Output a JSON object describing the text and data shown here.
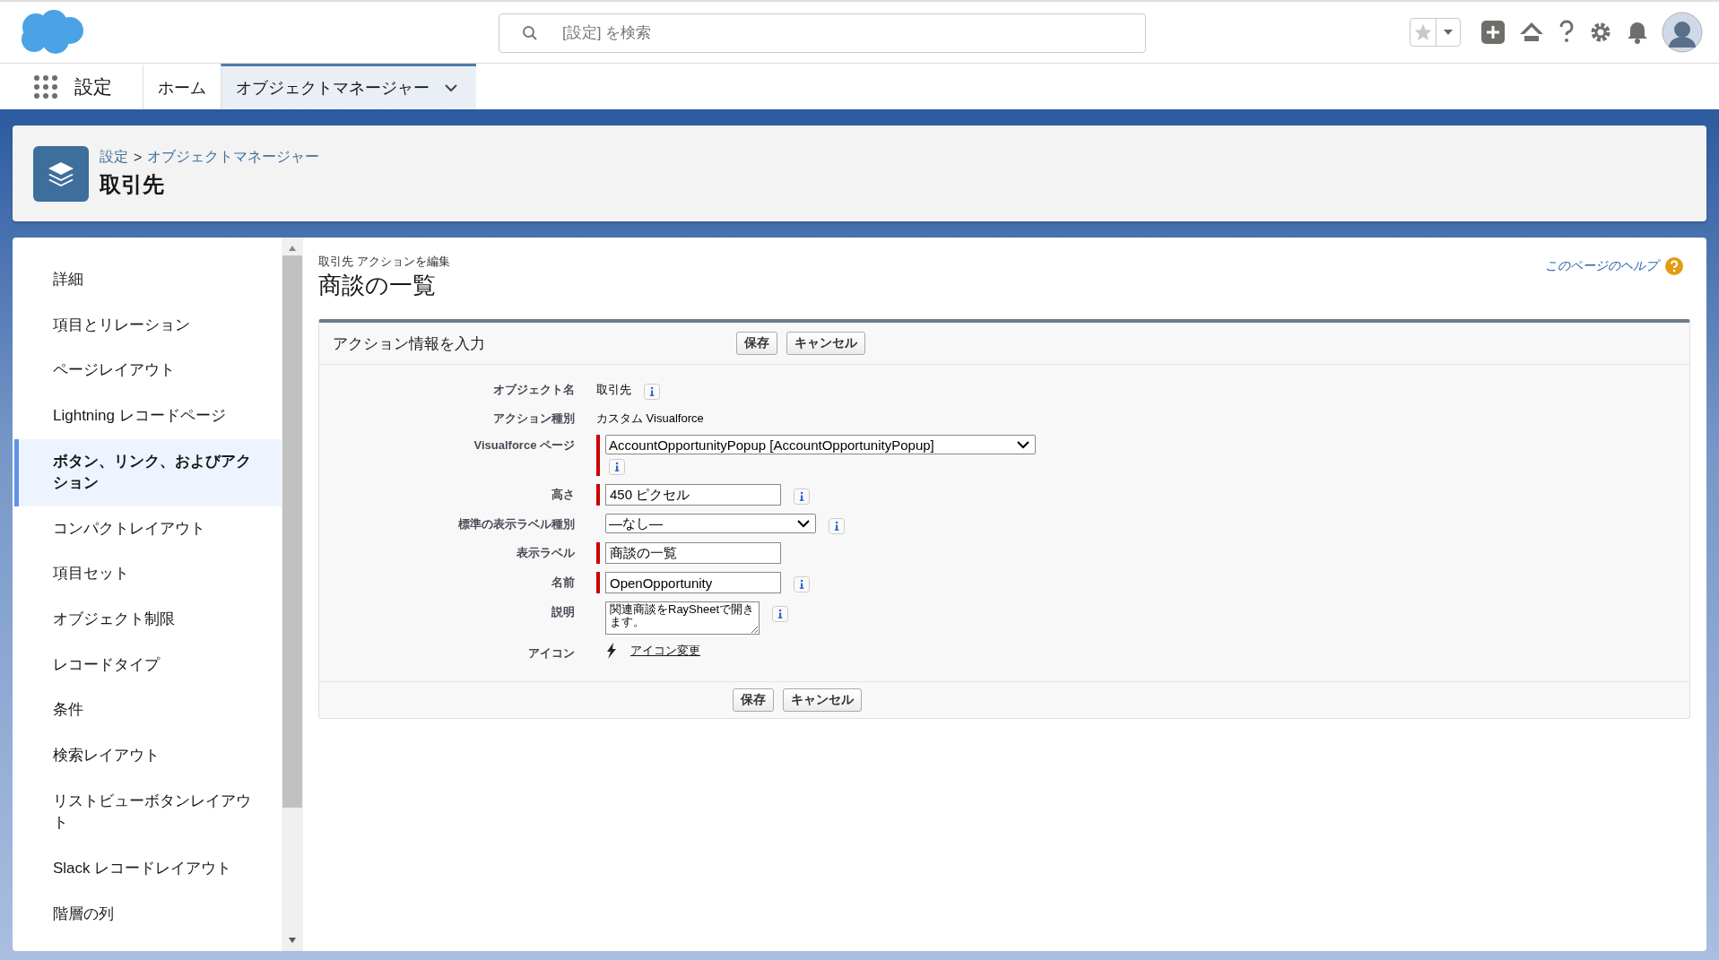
{
  "global_header": {
    "search": {
      "placeholder": "[設定] を検索"
    }
  },
  "nav": {
    "app_name": "設定",
    "tabs": [
      {
        "label": "ホーム",
        "selected": false,
        "dropdown": false
      },
      {
        "label": "オブジェクトマネージャー",
        "selected": true,
        "dropdown": true
      }
    ]
  },
  "page_header": {
    "breadcrumbs": [
      "設定",
      "オブジェクトマネージャー"
    ],
    "separator": ">",
    "title": "取引先"
  },
  "sidebar": {
    "items": [
      {
        "label": "詳細",
        "selected": false
      },
      {
        "label": "項目とリレーション",
        "selected": false
      },
      {
        "label": "ページレイアウト",
        "selected": false
      },
      {
        "label": "Lightning レコードページ",
        "selected": false
      },
      {
        "label": "ボタン、リンク、およびアクション",
        "selected": true
      },
      {
        "label": "コンパクトレイアウト",
        "selected": false
      },
      {
        "label": "項目セット",
        "selected": false
      },
      {
        "label": "オブジェクト制限",
        "selected": false
      },
      {
        "label": "レコードタイプ",
        "selected": false
      },
      {
        "label": "条件",
        "selected": false
      },
      {
        "label": "検索レイアウト",
        "selected": false
      },
      {
        "label": "リストビューボタンレイアウト",
        "selected": false
      },
      {
        "label": "Slack レコードレイアウト",
        "selected": false
      },
      {
        "label": "階層の列",
        "selected": false
      }
    ]
  },
  "content": {
    "subtitle": "取引先 アクションを編集",
    "title": "商談の一覧",
    "help_link": "このページのヘルプ",
    "section": {
      "title": "アクション情報を入力",
      "buttons": [
        "保存",
        "キャンセル"
      ],
      "footer_buttons": [
        "保存",
        "キャンセル"
      ],
      "fields": [
        {
          "label": "オブジェクト名",
          "kind": "text",
          "value": "取引先",
          "required": false,
          "info": true
        },
        {
          "label": "アクション種別",
          "kind": "text",
          "value": "カスタム Visualforce",
          "required": false,
          "info": false
        },
        {
          "label": "Visualforce ページ",
          "kind": "wideselect",
          "value": "AccountOpportunityPopup [AccountOpportunityPopup]",
          "required": true,
          "info": true
        },
        {
          "label": "高さ",
          "kind": "input",
          "value": "450 ピクセル",
          "required": true,
          "info": true
        },
        {
          "label": "標準の表示ラベル種別",
          "kind": "select",
          "value": "—なし—",
          "required": false,
          "info": true
        },
        {
          "label": "表示ラベル",
          "kind": "input",
          "value": "商談の一覧",
          "required": true,
          "info": false
        },
        {
          "label": "名前",
          "kind": "input",
          "value": "OpenOpportunity",
          "required": true,
          "info": true
        },
        {
          "label": "説明",
          "kind": "textarea",
          "value": "関連商談をRaySheetで開きます。",
          "required": false,
          "info": true
        },
        {
          "label": "アイコン",
          "kind": "icon",
          "value": "アイコン変更",
          "required": false,
          "info": false
        }
      ]
    }
  }
}
